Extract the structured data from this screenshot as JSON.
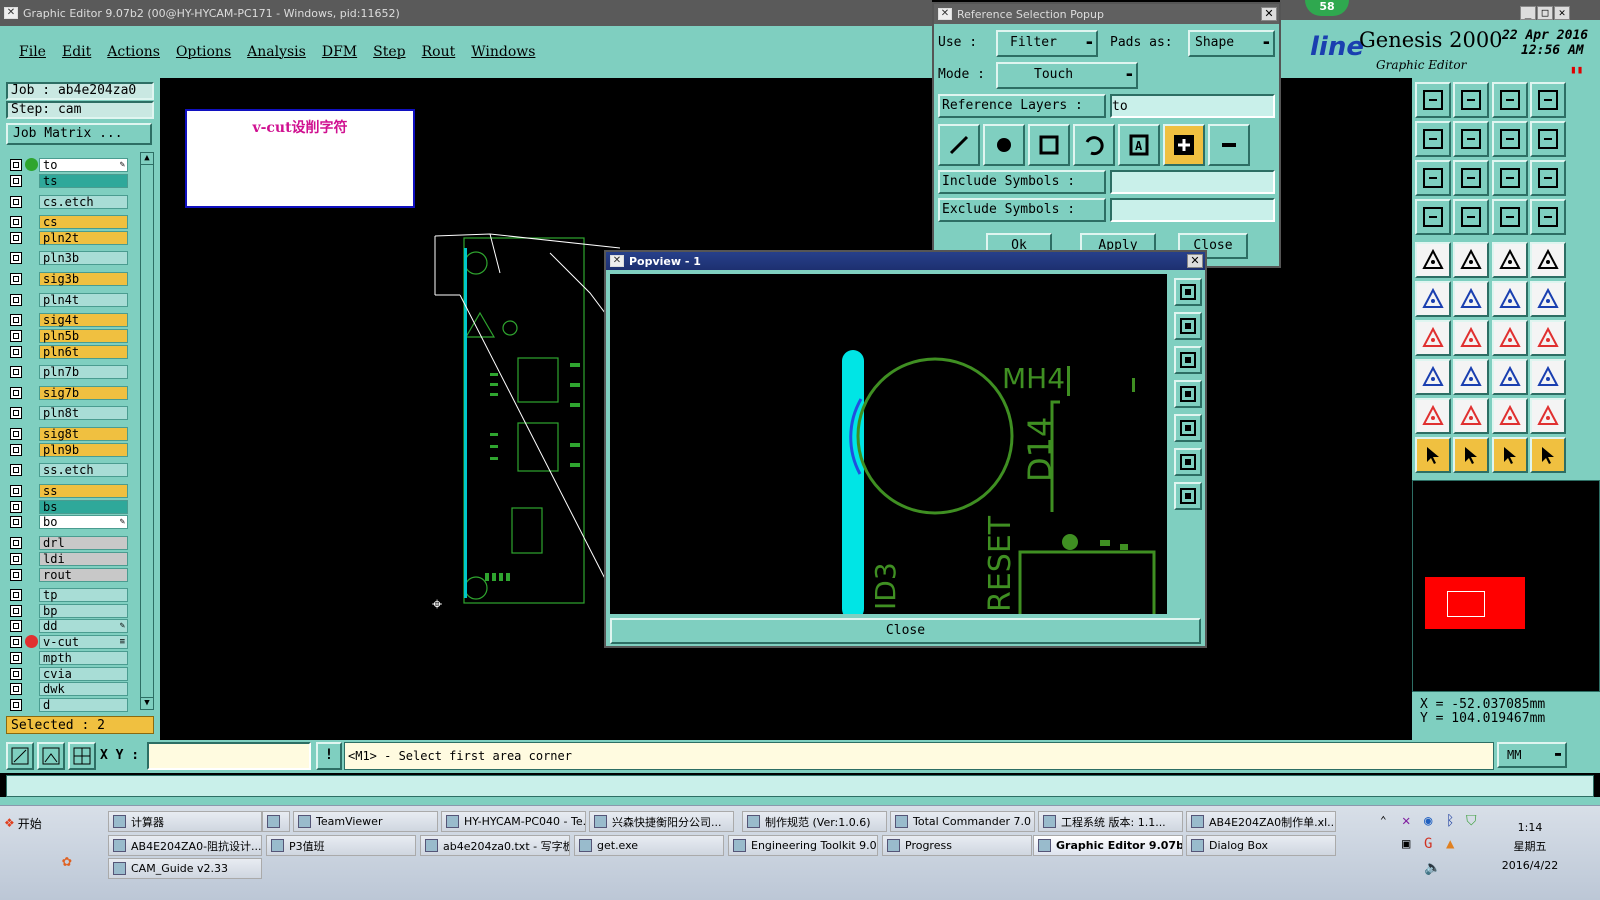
{
  "main_window": {
    "title": "Graphic Editor 9.07b2 (00@HY-HYCAM-PC171 - Windows, pid:11652)"
  },
  "menu": [
    "File",
    "Edit",
    "Actions",
    "Options",
    "Analysis",
    "DFM",
    "Step",
    "Rout",
    "Windows"
  ],
  "brand": {
    "partial": "line",
    "name": "Genesis 2000",
    "sub": "Graphic Editor",
    "date": "22 Apr 2016",
    "time": "12:56 AM",
    "badge": "58"
  },
  "job": {
    "job": "Job : ab4e204za0",
    "step": "Step: cam",
    "matrix_btn": "Job Matrix ..."
  },
  "layers": [
    {
      "name": "to",
      "color": "#ffffff",
      "mark": "edit",
      "dot": "#2fa52f"
    },
    {
      "name": "ts",
      "color": "#2fa89a"
    },
    {
      "name": "cs.etch",
      "color": "#a8ddd6"
    },
    {
      "name": "cs",
      "color": "#f0c040"
    },
    {
      "name": "pln2t",
      "color": "#f0c040"
    },
    {
      "name": "pln3b",
      "color": "#a8ddd6"
    },
    {
      "name": "sig3b",
      "color": "#f0c040"
    },
    {
      "name": "pln4t",
      "color": "#a8ddd6"
    },
    {
      "name": "sig4t",
      "color": "#f0c040"
    },
    {
      "name": "pln5b",
      "color": "#f0c040"
    },
    {
      "name": "pln6t",
      "color": "#f0c040"
    },
    {
      "name": "pln7b",
      "color": "#a8ddd6"
    },
    {
      "name": "sig7b",
      "color": "#f0c040"
    },
    {
      "name": "pln8t",
      "color": "#a8ddd6"
    },
    {
      "name": "sig8t",
      "color": "#f0c040"
    },
    {
      "name": "pln9b",
      "color": "#f0c040"
    },
    {
      "name": "ss.etch",
      "color": "#a8ddd6"
    },
    {
      "name": "ss",
      "color": "#f0c040"
    },
    {
      "name": "bs",
      "color": "#2fa89a"
    },
    {
      "name": "bo",
      "color": "#ffffff",
      "mark": "edit"
    },
    {
      "name": "drl",
      "color": "#c8c8c8"
    },
    {
      "name": "ldi",
      "color": "#c8c8c8"
    },
    {
      "name": "rout",
      "color": "#c8c8c8"
    },
    {
      "name": "tp",
      "color": "#a8ddd6"
    },
    {
      "name": "bp",
      "color": "#a8ddd6"
    },
    {
      "name": "dd",
      "color": "#a8ddd6",
      "mark": "edit"
    },
    {
      "name": "v-cut",
      "color": "#a8ddd6",
      "mark": "menu",
      "dot": "#e03030"
    },
    {
      "name": "mpth",
      "color": "#a8ddd6"
    },
    {
      "name": "cvia",
      "color": "#a8ddd6"
    },
    {
      "name": "dwk",
      "color": "#a8ddd6"
    },
    {
      "name": "d",
      "color": "#a8ddd6"
    }
  ],
  "selected": "Selected : 2",
  "note_box": {
    "text": "v-cut设削字符"
  },
  "status": {
    "xy_label": "X Y :",
    "xy_value": "",
    "prompt": "<M1> - Select first area corner",
    "units": "MM"
  },
  "coords": {
    "x": "X = -52.037085mm",
    "y": "Y = 104.019467mm"
  },
  "ref_popup": {
    "title": "Reference Selection Popup",
    "use_label": "Use  :",
    "use_value": "Filter",
    "pads_label": "Pads as:",
    "pads_value": "Shape",
    "mode_label": "Mode :",
    "mode_value": "Touch",
    "ref_layers_label": "Reference Layers :",
    "ref_layers_value": "to",
    "include_label": "Include Symbols :",
    "include_value": "",
    "exclude_label": "Exclude Symbols :",
    "exclude_value": "",
    "ok": "Ok",
    "apply": "Apply",
    "close": "Close"
  },
  "popview": {
    "title": "Popview - 1",
    "close": "Close",
    "labels": {
      "mh": "MH4",
      "d14": "D14",
      "id3": "ID3",
      "reset": "RESET"
    }
  },
  "taskbar": {
    "start": "开始",
    "row1": [
      {
        "label": "计算器"
      },
      {
        "label": ""
      },
      {
        "label": "TeamViewer"
      },
      {
        "label": "HY-HYCAM-PC040 - Te..."
      },
      {
        "label": "兴森快捷衡阳分公司..."
      },
      {
        "label": "制作规范 (Ver:1.0.6)"
      },
      {
        "label": "Total Commander 7.0 ..."
      },
      {
        "label": "工程系统  版本: 1.1..."
      },
      {
        "label": "AB4E204ZA0制作单.xl..."
      }
    ],
    "row2": [
      {
        "label": "AB4E204ZA0-阻抗设计..."
      },
      {
        "label": "P3值班"
      },
      {
        "label": "ab4e204za0.txt - 写字板"
      },
      {
        "label": "get.exe"
      },
      {
        "label": "Engineering Toolkit 9.07..."
      },
      {
        "label": "Progress"
      },
      {
        "label": "Graphic Editor 9.07b...",
        "active": true
      },
      {
        "label": "Dialog Box"
      }
    ],
    "row3": [
      {
        "label": "CAM_Guide v2.33"
      }
    ],
    "clock": {
      "time": "1:14",
      "day": "星期五",
      "date": "2016/4/22"
    }
  },
  "colors": {
    "teal": "#7fcfc0",
    "silk": "#3f8f22",
    "cyan": "#00e5e5",
    "yellow": "#f0c040",
    "red": "#ff0000"
  }
}
